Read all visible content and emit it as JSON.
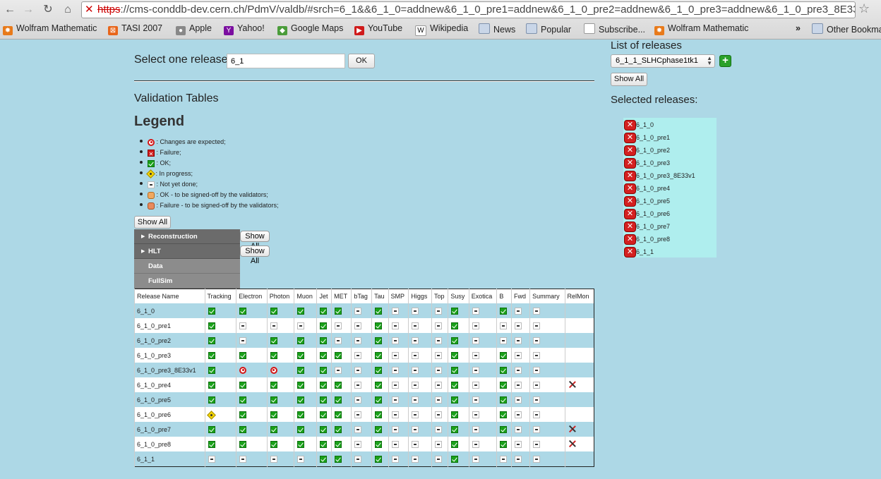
{
  "browser": {
    "url_scheme": "https",
    "url_rest": "://cms-conddb-dev.cern.ch/PdmV/valdb/#srch=6_1&&6_1_0=addnew&6_1_0_pre1=addnew&6_1_0_pre2=addnew&6_1_0_pre3=addnew&6_1_0_pre3_8E33v1=...",
    "bookmarks": [
      "Wolfram Mathematic",
      "TASI 2007",
      "Apple",
      "Yahoo!",
      "Google Maps",
      "YouTube",
      "Wikipedia",
      "News",
      "Popular",
      "Subscribe...",
      "Wolfram Mathematic",
      "»",
      "Other Bookmarks"
    ]
  },
  "release_select": {
    "label": "Select one release",
    "value": "6_1",
    "ok": "OK"
  },
  "validation_title": "Validation Tables",
  "legend": {
    "title": "Legend",
    "items": [
      {
        "icon": "changes-expected-icon",
        "text": ": Changes are expected;"
      },
      {
        "icon": "failure-icon",
        "text": ": Failure;"
      },
      {
        "icon": "ok-icon",
        "text": ": OK;"
      },
      {
        "icon": "in-progress-icon",
        "text": ": In progress;"
      },
      {
        "icon": "not-yet-done-icon",
        "text": ": Not yet done;"
      },
      {
        "icon": "ok-signoff-icon",
        "text": ": OK - to be signed-off by the validators;"
      },
      {
        "icon": "failure-signoff-icon",
        "text": ": Failure - to be signed-off by the validators;"
      }
    ]
  },
  "show_all": "Show All",
  "categories": [
    {
      "label": "Reconstruction",
      "expandable": true,
      "show_all": "Show All"
    },
    {
      "label": "HLT",
      "expandable": true,
      "show_all": "Show All"
    },
    {
      "label": "Data",
      "expandable": false
    },
    {
      "label": "FullSim",
      "expandable": false
    }
  ],
  "table": {
    "headers": [
      "Release Name",
      "Tracking",
      "Electron",
      "Photon",
      "Muon",
      "Jet",
      "MET",
      "bTag",
      "Tau",
      "SMP",
      "Higgs",
      "Top",
      "Susy",
      "Exotica",
      "B",
      "Fwd",
      "Summary",
      "RelMon"
    ],
    "rows": [
      {
        "name": "6_1_0",
        "cells": [
          "ok",
          "ok",
          "ok",
          "ok",
          "ok",
          "ok",
          "nd",
          "ok",
          "nd",
          "nd",
          "nd",
          "ok",
          "nd",
          "ok",
          "nd",
          "nd",
          ""
        ]
      },
      {
        "name": "6_1_0_pre1",
        "cells": [
          "ok",
          "nd",
          "nd",
          "nd",
          "ok",
          "nd",
          "nd",
          "ok",
          "nd",
          "nd",
          "nd",
          "ok",
          "nd",
          "nd",
          "nd",
          "nd",
          ""
        ]
      },
      {
        "name": "6_1_0_pre2",
        "cells": [
          "ok",
          "nd",
          "ok",
          "ok",
          "ok",
          "nd",
          "nd",
          "ok",
          "nd",
          "nd",
          "nd",
          "ok",
          "nd",
          "nd",
          "nd",
          "nd",
          ""
        ]
      },
      {
        "name": "6_1_0_pre3",
        "cells": [
          "ok",
          "ok",
          "ok",
          "ok",
          "ok",
          "ok",
          "nd",
          "ok",
          "nd",
          "nd",
          "nd",
          "ok",
          "nd",
          "ok",
          "nd",
          "nd",
          ""
        ]
      },
      {
        "name": "6_1_0_pre3_8E33v1",
        "cells": [
          "ok",
          "ch",
          "ch",
          "ok",
          "ok",
          "nd",
          "nd",
          "ok",
          "nd",
          "nd",
          "nd",
          "ok",
          "nd",
          "ok",
          "nd",
          "nd",
          ""
        ]
      },
      {
        "name": "6_1_0_pre4",
        "cells": [
          "ok",
          "ok",
          "ok",
          "ok",
          "ok",
          "ok",
          "nd",
          "ok",
          "nd",
          "nd",
          "nd",
          "ok",
          "nd",
          "ok",
          "nd",
          "nd",
          "relx"
        ]
      },
      {
        "name": "6_1_0_pre5",
        "cells": [
          "ok",
          "ok",
          "ok",
          "ok",
          "ok",
          "ok",
          "nd",
          "ok",
          "nd",
          "nd",
          "nd",
          "ok",
          "nd",
          "ok",
          "nd",
          "nd",
          ""
        ]
      },
      {
        "name": "6_1_0_pre6",
        "cells": [
          "prog",
          "ok",
          "ok",
          "ok",
          "ok",
          "ok",
          "nd",
          "ok",
          "nd",
          "nd",
          "nd",
          "ok",
          "nd",
          "ok",
          "nd",
          "nd",
          ""
        ]
      },
      {
        "name": "6_1_0_pre7",
        "cells": [
          "ok",
          "ok",
          "ok",
          "ok",
          "ok",
          "ok",
          "nd",
          "ok",
          "nd",
          "nd",
          "nd",
          "ok",
          "nd",
          "ok",
          "nd",
          "nd",
          "relx"
        ]
      },
      {
        "name": "6_1_0_pre8",
        "cells": [
          "ok",
          "ok",
          "ok",
          "ok",
          "ok",
          "ok",
          "nd",
          "ok",
          "nd",
          "nd",
          "nd",
          "ok",
          "nd",
          "ok",
          "nd",
          "nd",
          "relx"
        ]
      },
      {
        "name": "6_1_1",
        "cells": [
          "nd",
          "nd",
          "nd",
          "nd",
          "ok",
          "ok",
          "nd",
          "ok",
          "nd",
          "nd",
          "nd",
          "ok",
          "nd",
          "nd",
          "nd",
          "nd",
          ""
        ]
      }
    ]
  },
  "right": {
    "list_title": "List of releases",
    "selected_option": "6_1_1_SLHCphase1tk1",
    "show_all": "Show All",
    "selected_title": "Selected releases:",
    "selected": [
      "6_1_0",
      "6_1_0_pre1",
      "6_1_0_pre2",
      "6_1_0_pre3",
      "6_1_0_pre3_8E33v1",
      "6_1_0_pre4",
      "6_1_0_pre5",
      "6_1_0_pre6",
      "6_1_0_pre7",
      "6_1_0_pre8",
      "6_1_1"
    ]
  }
}
